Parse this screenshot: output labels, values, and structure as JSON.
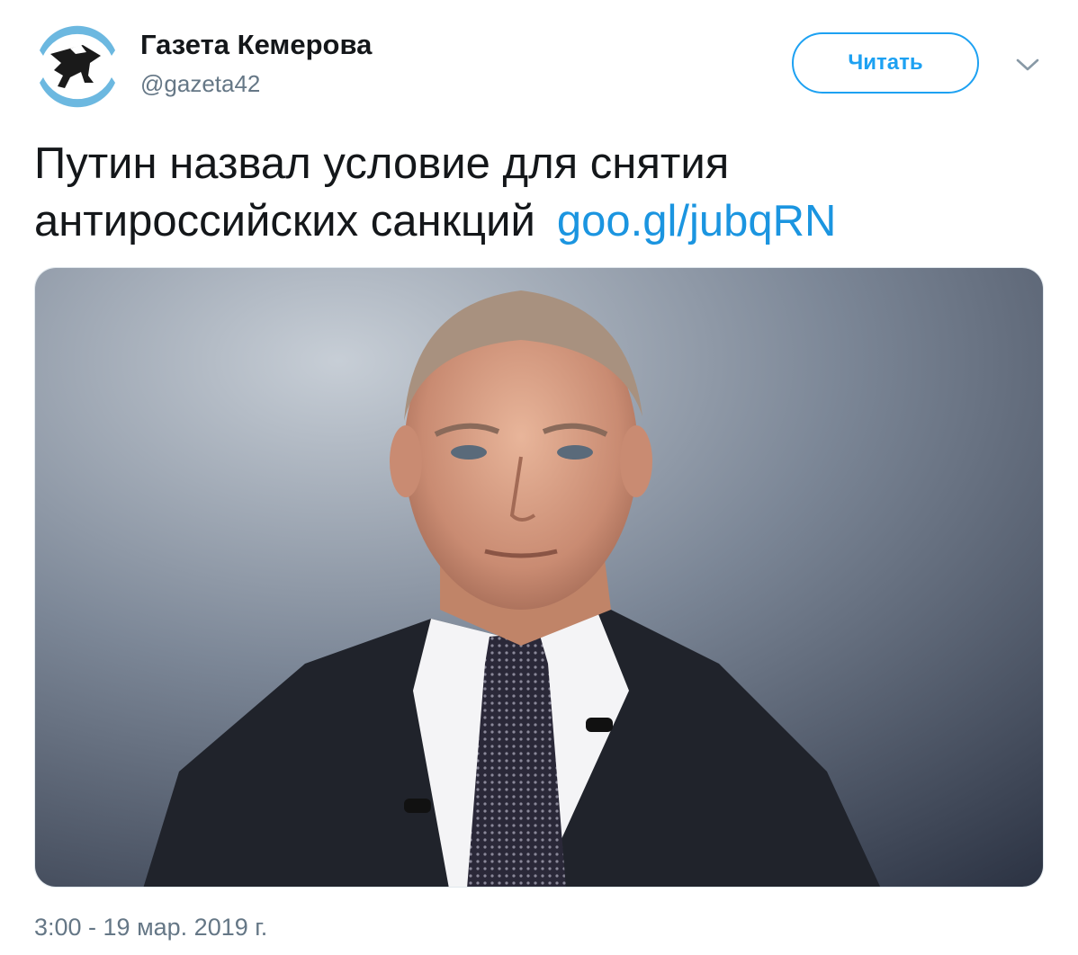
{
  "author": {
    "display_name": "Газета Кемерова",
    "handle": "@gazeta42"
  },
  "follow_button_label": "Читать",
  "tweet": {
    "text": "Путин назвал условие для снятия антироссийских санкций",
    "link": "goo.gl/jubqRN",
    "timestamp": "3:00 - 19 мар. 2019 г."
  },
  "colors": {
    "accent": "#1da1f2",
    "link": "#1b95e0",
    "secondary_text": "#657786"
  },
  "icons": {
    "caret": "chevron-down-icon"
  }
}
